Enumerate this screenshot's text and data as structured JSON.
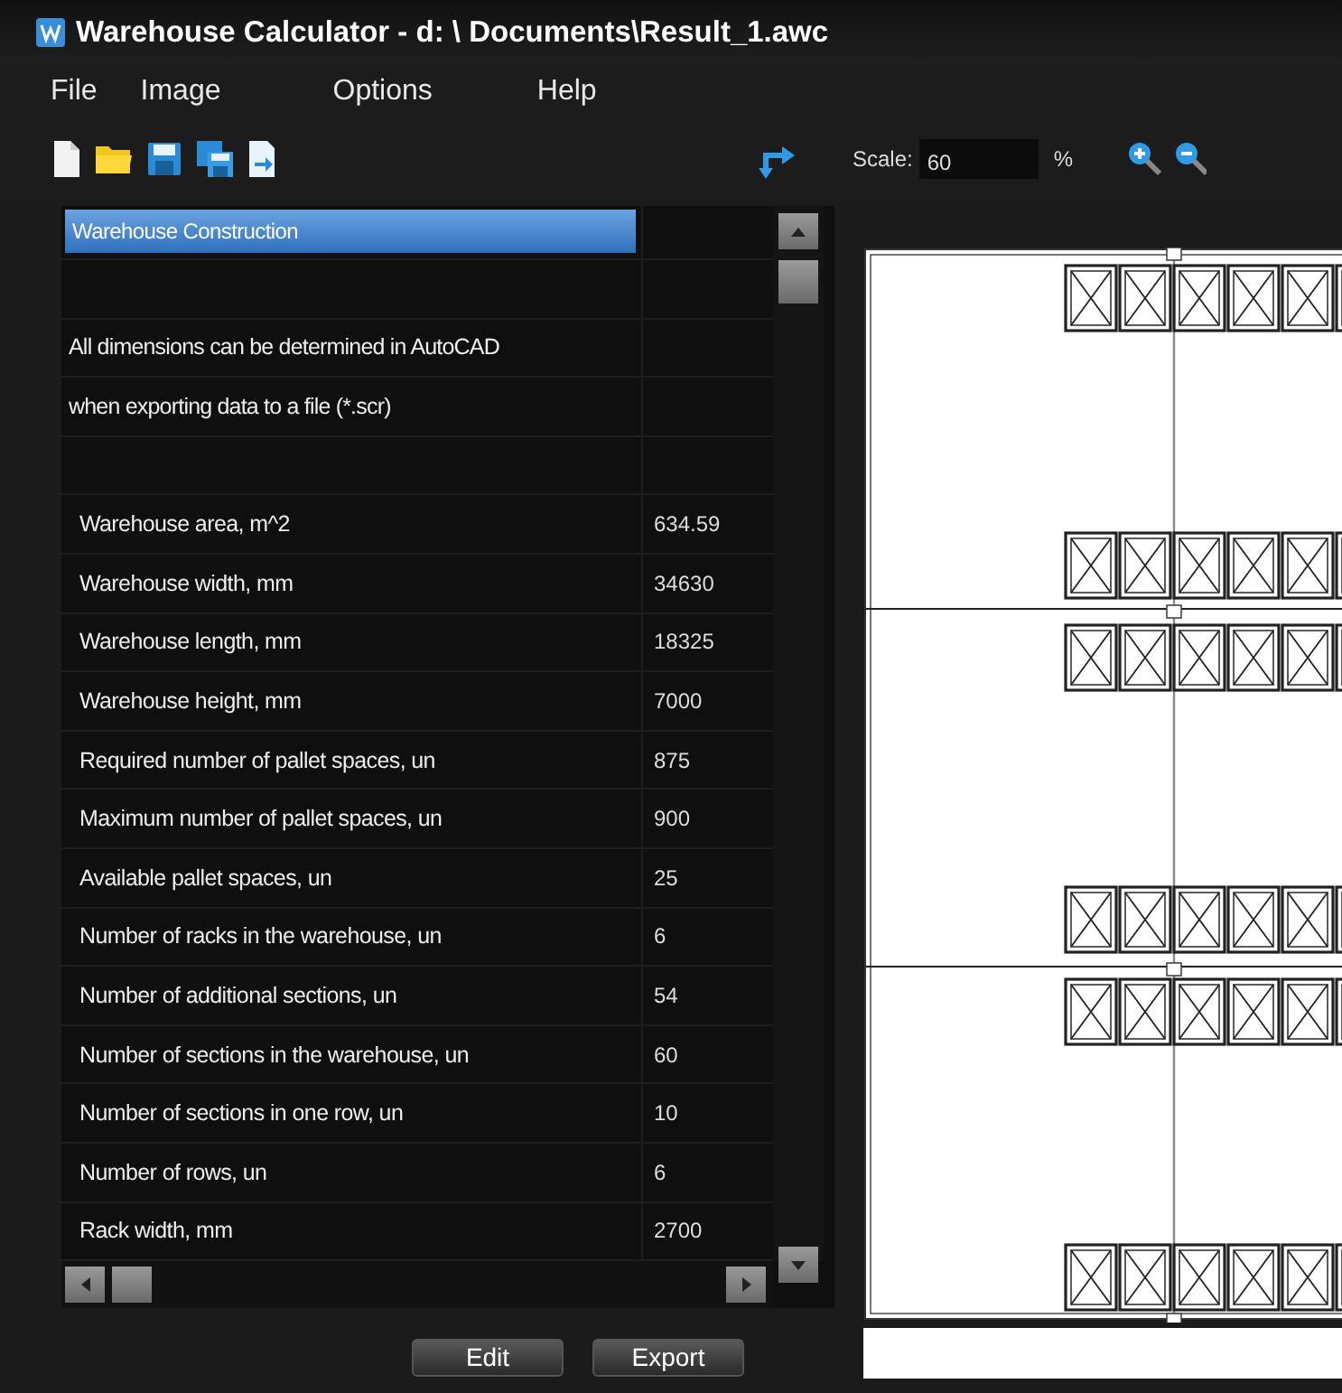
{
  "window": {
    "title": "Warehouse Calculator - d: \\ Documents\\Result_1.awc"
  },
  "menu": [
    {
      "label": "File"
    },
    {
      "label": "Image"
    },
    {
      "label": "Options"
    },
    {
      "label": "Help"
    }
  ],
  "toolbar": {
    "scale_label": "Scale:",
    "scale_value": "60",
    "scale_unit": "%"
  },
  "table": {
    "rows": [
      {
        "kind": "header",
        "label": "Warehouse Construction",
        "selected": true
      },
      {
        "kind": "blank",
        "selected": false
      },
      {
        "kind": "note",
        "label": "All dimensions can be determined in AutoCAD",
        "selected": false
      },
      {
        "kind": "note",
        "label": "when exporting data to a file (*.scr)",
        "selected": false
      },
      {
        "kind": "blank",
        "selected": false
      },
      {
        "kind": "param",
        "label": "Warehouse area, m^2",
        "value": "634.59",
        "selected": false
      },
      {
        "kind": "param",
        "label": "Warehouse width, mm",
        "value": "34630",
        "selected": false
      },
      {
        "kind": "param",
        "label": "Warehouse length, mm",
        "value": "18325",
        "selected": false
      },
      {
        "kind": "param",
        "label": "Warehouse height, mm",
        "value": "7000",
        "selected": false
      },
      {
        "kind": "param",
        "label": "Required number of pallet spaces, un",
        "value": "875",
        "selected": false
      },
      {
        "kind": "param",
        "label": "Maximum number of pallet spaces, un",
        "value": "900",
        "selected": false
      },
      {
        "kind": "param",
        "label": "Available pallet spaces, un",
        "value": "25",
        "selected": false
      },
      {
        "kind": "param",
        "label": "Number of racks in the warehouse, un",
        "value": "6",
        "selected": false
      },
      {
        "kind": "param",
        "label": "Number of additional sections, un",
        "value": "54",
        "selected": false
      },
      {
        "kind": "param",
        "label": "Number of sections in the warehouse, un",
        "value": "60",
        "selected": false
      },
      {
        "kind": "param",
        "label": "Number of sections in one row, un",
        "value": "10",
        "selected": false
      },
      {
        "kind": "param",
        "label": "Number of rows, un",
        "value": "6",
        "selected": false
      },
      {
        "kind": "param",
        "label": "Rack width, mm",
        "value": "2700",
        "selected": false
      }
    ]
  },
  "buttons": [
    {
      "label": "Edit"
    },
    {
      "label": "Export"
    }
  ]
}
